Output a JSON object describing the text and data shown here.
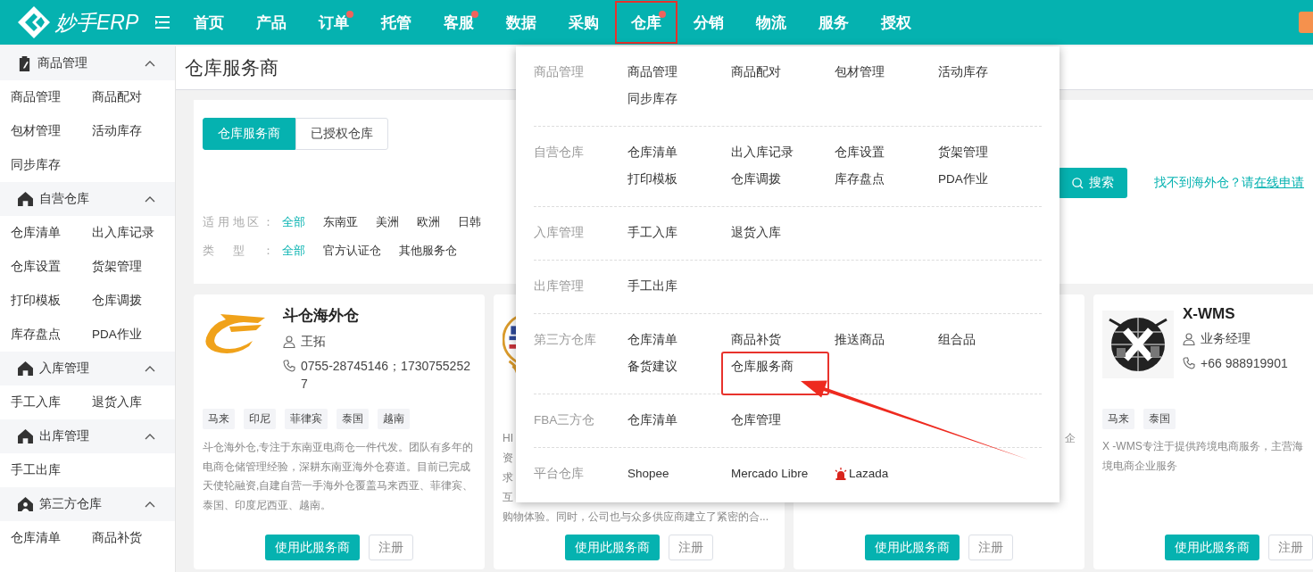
{
  "app": {
    "logo_text": "妙手ERP"
  },
  "nav": [
    {
      "label": "首页",
      "dot": false,
      "highlighted": false
    },
    {
      "label": "产品",
      "dot": false,
      "highlighted": false
    },
    {
      "label": "订单",
      "dot": true,
      "highlighted": false
    },
    {
      "label": "托管",
      "dot": false,
      "highlighted": false
    },
    {
      "label": "客服",
      "dot": true,
      "highlighted": false
    },
    {
      "label": "数据",
      "dot": false,
      "highlighted": false
    },
    {
      "label": "采购",
      "dot": false,
      "highlighted": false
    },
    {
      "label": "仓库",
      "dot": true,
      "highlighted": true
    },
    {
      "label": "分销",
      "dot": false,
      "highlighted": false
    },
    {
      "label": "物流",
      "dot": false,
      "highlighted": false
    },
    {
      "label": "服务",
      "dot": false,
      "highlighted": false
    },
    {
      "label": "授权",
      "dot": false,
      "highlighted": false
    }
  ],
  "sidebar": [
    {
      "title": "商品管理",
      "kind": "clipboard",
      "expanded": true,
      "items": [
        "商品管理",
        "商品配对",
        "包材管理",
        "活动库存",
        "同步库存"
      ]
    },
    {
      "title": "自营仓库",
      "kind": "house",
      "expanded": true,
      "items": [
        "仓库清单",
        "出入库记录",
        "仓库设置",
        "货架管理",
        "打印模板",
        "仓库调拨",
        "库存盘点",
        "PDA作业"
      ]
    },
    {
      "title": "入库管理",
      "kind": "house",
      "expanded": true,
      "items": [
        "手工入库",
        "退货入库"
      ]
    },
    {
      "title": "出库管理",
      "kind": "house",
      "expanded": true,
      "items": [
        "手工出库"
      ]
    },
    {
      "title": "第三方仓库",
      "kind": "person-house",
      "expanded": true,
      "items": [
        "仓库清单",
        "商品补货"
      ]
    }
  ],
  "page_title": "仓库服务商",
  "tabs": [
    {
      "label": "仓库服务商",
      "selected": true
    },
    {
      "label": "已授权仓库",
      "selected": false
    }
  ],
  "search_button": "搜索",
  "help": {
    "text": "找不到海外仓？请",
    "link": "在线申请"
  },
  "filters": [
    {
      "label": "适用地区：",
      "options": [
        {
          "label": "全部",
          "selected": true
        },
        {
          "label": "东南亚",
          "selected": false
        },
        {
          "label": "美洲",
          "selected": false
        },
        {
          "label": "欧洲",
          "selected": false
        },
        {
          "label": "日韩",
          "selected": false
        }
      ]
    },
    {
      "label": "类型：",
      "options": [
        {
          "label": "全部",
          "selected": true
        },
        {
          "label": "官方认证仓",
          "selected": false
        },
        {
          "label": "其他服务仓",
          "selected": false
        }
      ]
    }
  ],
  "cards": [
    {
      "kind": "swoosh",
      "title": "斗仓海外仓",
      "contact": "王拓",
      "phone": "0755-28745146；17307552527",
      "tags": [
        "马来",
        "印尼",
        "菲律宾",
        "泰国",
        "越南"
      ],
      "description": "斗仓海外仓,专注于东南亚电商仓一件代发。团队有多年的电商仓储管理经验，深耕东南亚海外仓赛道。目前已完成天使轮融资,自建自营一手海外仓覆盖马来西亚、菲律宾、泰国、印度尼西亚、越南。",
      "use_button": "使用此服务商",
      "register_button": "注册"
    },
    {
      "kind": "emblem",
      "description_lines": [
        "HI",
        "资",
        "求",
        "互",
        "购物体验。同时，公司也与众多供应商建立了紧密的合..."
      ],
      "use_button": "使用此服务商",
      "register_button": "注册"
    },
    {
      "kind": "covered",
      "description_lines": [
        "企"
      ],
      "use_button": "使用此服务商",
      "register_button": "注册"
    },
    {
      "kind": "globe",
      "title": "X-WMS",
      "contact": "业务经理",
      "phone": "+66 988919901",
      "tags": [
        "马来",
        "泰国"
      ],
      "description_lines": [
        "X -WMS专注于提供跨境电商服务，主营海",
        "境电商企业服务"
      ],
      "use_button": "使用此服务商",
      "register_button": "注册"
    }
  ],
  "dropdown": {
    "sections": [
      {
        "label": "商品管理",
        "items": [
          {
            "label": "商品管理",
            "highlighted": false,
            "alert": false
          },
          {
            "label": "商品配对",
            "highlighted": false,
            "alert": false
          },
          {
            "label": "包材管理",
            "highlighted": false,
            "alert": false
          },
          {
            "label": "活动库存",
            "highlighted": false,
            "alert": false
          },
          {
            "label": "同步库存",
            "highlighted": false,
            "alert": false
          }
        ]
      },
      {
        "label": "自营仓库",
        "items": [
          {
            "label": "仓库清单",
            "highlighted": false,
            "alert": false
          },
          {
            "label": "出入库记录",
            "highlighted": false,
            "alert": false
          },
          {
            "label": "仓库设置",
            "highlighted": false,
            "alert": false
          },
          {
            "label": "货架管理",
            "highlighted": false,
            "alert": false
          },
          {
            "label": "打印模板",
            "highlighted": false,
            "alert": false
          },
          {
            "label": "仓库调拨",
            "highlighted": false,
            "alert": false
          },
          {
            "label": "库存盘点",
            "highlighted": false,
            "alert": false
          },
          {
            "label": "PDA作业",
            "highlighted": false,
            "alert": false
          }
        ]
      },
      {
        "label": "入库管理",
        "items": [
          {
            "label": "手工入库",
            "highlighted": false,
            "alert": false
          },
          {
            "label": "退货入库",
            "highlighted": false,
            "alert": false
          }
        ]
      },
      {
        "label": "出库管理",
        "items": [
          {
            "label": "手工出库",
            "highlighted": false,
            "alert": false
          }
        ]
      },
      {
        "label": "第三方仓库",
        "items": [
          {
            "label": "仓库清单",
            "highlighted": false,
            "alert": false
          },
          {
            "label": "商品补货",
            "highlighted": false,
            "alert": false
          },
          {
            "label": "推送商品",
            "highlighted": false,
            "alert": false
          },
          {
            "label": "组合品",
            "highlighted": false,
            "alert": false
          },
          {
            "label": "备货建议",
            "highlighted": false,
            "alert": false
          },
          {
            "label": "仓库服务商",
            "highlighted": true,
            "alert": false
          }
        ]
      },
      {
        "label": "FBA三方仓",
        "items": [
          {
            "label": "仓库清单",
            "highlighted": false,
            "alert": false
          },
          {
            "label": "仓库管理",
            "highlighted": false,
            "alert": false
          }
        ]
      },
      {
        "label": "平台仓库",
        "items": [
          {
            "label": "Shopee",
            "highlighted": false,
            "alert": false
          },
          {
            "label": "Mercado Libre",
            "highlighted": false,
            "alert": false
          },
          {
            "label": "Lazada",
            "highlighted": false,
            "alert": true
          }
        ]
      }
    ]
  }
}
